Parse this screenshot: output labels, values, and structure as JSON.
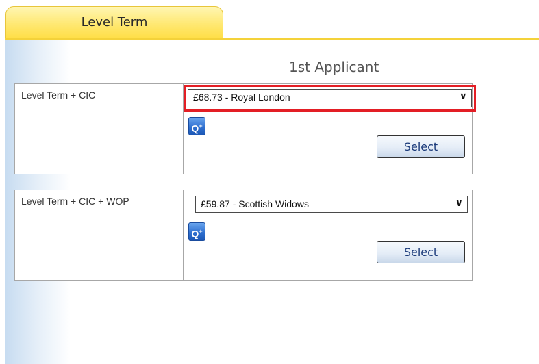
{
  "tab": {
    "label": "Level Term"
  },
  "header": {
    "applicant": "1st Applicant"
  },
  "products": [
    {
      "name": "Level Term + CIC",
      "selected_quote": "£68.73 - Royal London",
      "highlighted": true,
      "select_label": "Select",
      "quote_icon": "Q+"
    },
    {
      "name": "Level Term + CIC + WOP",
      "selected_quote": "£59.87 - Scottish Widows",
      "highlighted": false,
      "select_label": "Select",
      "quote_icon": "Q+"
    }
  ],
  "colors": {
    "tab_bg": "#ffe871",
    "tab_border": "#e8c53a",
    "highlight_border": "#e31e25",
    "icon_blue": "#2f70d0",
    "panel_gradient": "#c7dcf1"
  }
}
